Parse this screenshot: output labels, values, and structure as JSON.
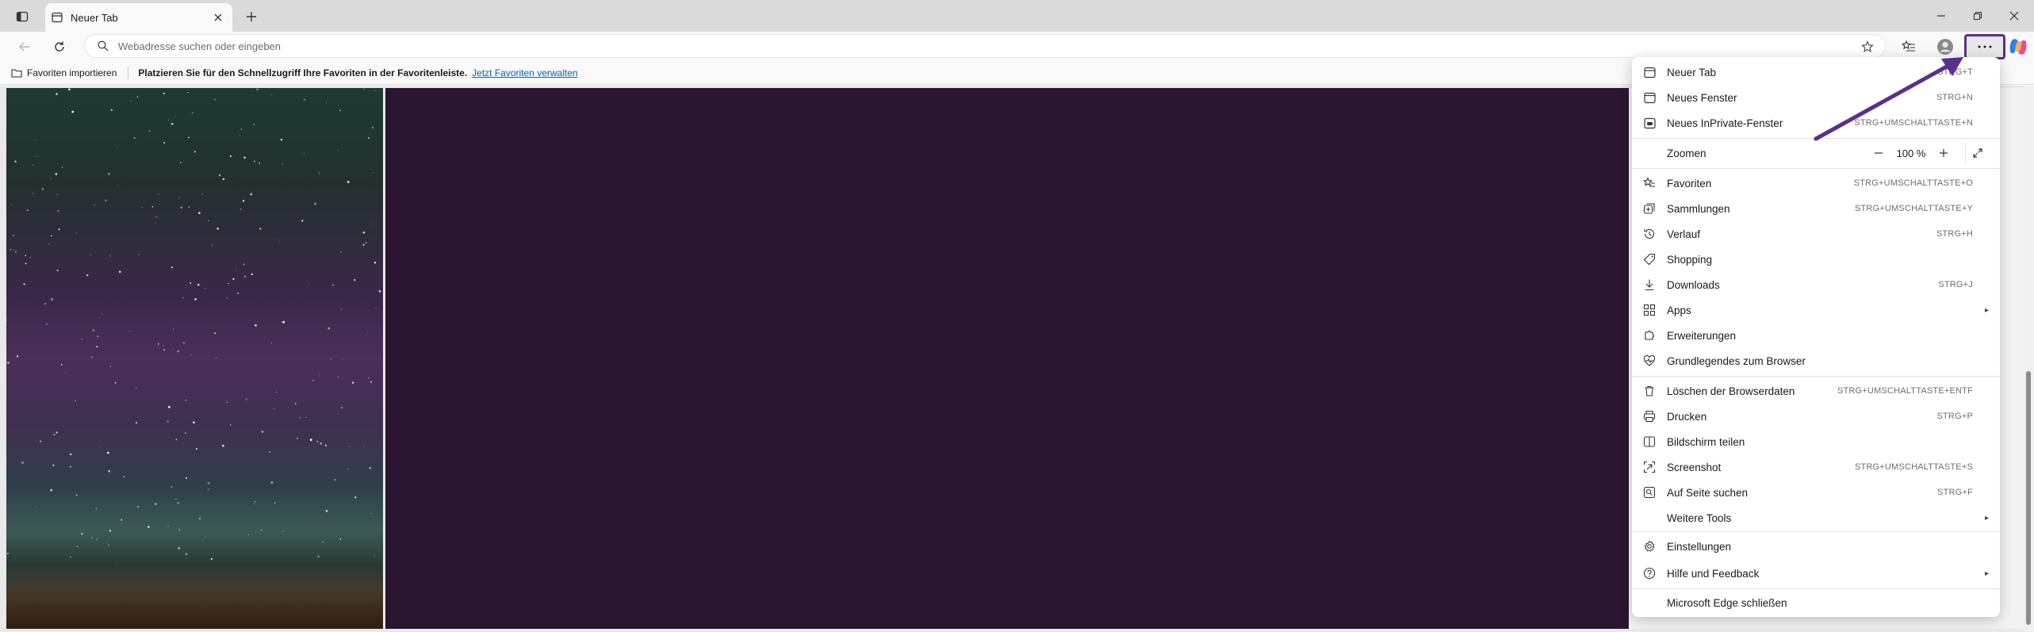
{
  "window": {
    "tab_title": "Neuer Tab"
  },
  "toolbar": {
    "address_placeholder": "Webadresse suchen oder eingeben"
  },
  "favorites_bar": {
    "import_label": "Favoriten importieren",
    "hint": "Platzieren Sie für den Schnellzugriff Ihre Favoriten in der Favoritenleiste.",
    "manage_link": "Jetzt Favoriten verwalten"
  },
  "menu": {
    "items": [
      {
        "label": "Neuer Tab",
        "shortcut": "STRG+T",
        "icon": "new-tab-icon"
      },
      {
        "label": "Neues Fenster",
        "shortcut": "STRG+N",
        "icon": "new-window-icon"
      },
      {
        "label": "Neues InPrivate-Fenster",
        "shortcut": "STRG+UMSCHALTTASTE+N",
        "icon": "inprivate-icon"
      },
      {
        "label": "Zoomen",
        "zoom": "100 %"
      },
      {
        "label": "Favoriten",
        "shortcut": "STRG+UMSCHALTTASTE+O",
        "icon": "favorites-icon"
      },
      {
        "label": "Sammlungen",
        "shortcut": "STRG+UMSCHALTTASTE+Y",
        "icon": "collections-icon"
      },
      {
        "label": "Verlauf",
        "shortcut": "STRG+H",
        "icon": "history-icon"
      },
      {
        "label": "Shopping",
        "shortcut": "",
        "icon": "shopping-tag-icon"
      },
      {
        "label": "Downloads",
        "shortcut": "STRG+J",
        "icon": "download-icon"
      },
      {
        "label": "Apps",
        "shortcut": "",
        "icon": "apps-icon",
        "submenu": true
      },
      {
        "label": "Erweiterungen",
        "shortcut": "",
        "icon": "extensions-icon"
      },
      {
        "label": "Grundlegendes zum Browser",
        "shortcut": "",
        "icon": "browser-essentials-icon"
      },
      {
        "label": "Löschen der Browserdaten",
        "shortcut": "STRG+UMSCHALTTASTE+ENTF",
        "icon": "trash-icon"
      },
      {
        "label": "Drucken",
        "shortcut": "STRG+P",
        "icon": "print-icon"
      },
      {
        "label": "Bildschirm teilen",
        "shortcut": "",
        "icon": "split-screen-icon"
      },
      {
        "label": "Screenshot",
        "shortcut": "STRG+UMSCHALTTASTE+S",
        "icon": "screenshot-icon"
      },
      {
        "label": "Auf Seite suchen",
        "shortcut": "STRG+F",
        "icon": "find-icon"
      },
      {
        "label": "Weitere Tools",
        "shortcut": "",
        "icon": "",
        "submenu": true
      },
      {
        "label": "Einstellungen",
        "shortcut": "",
        "icon": "gear-icon"
      },
      {
        "label": "Hilfe und Feedback",
        "shortcut": "",
        "icon": "help-icon",
        "submenu": true
      },
      {
        "label": "Microsoft Edge schließen",
        "shortcut": "",
        "icon": ""
      }
    ]
  },
  "colors": {
    "accent_annotation": "#5b2f8a",
    "content_dark": "#2b1631",
    "link": "#0067b8"
  }
}
